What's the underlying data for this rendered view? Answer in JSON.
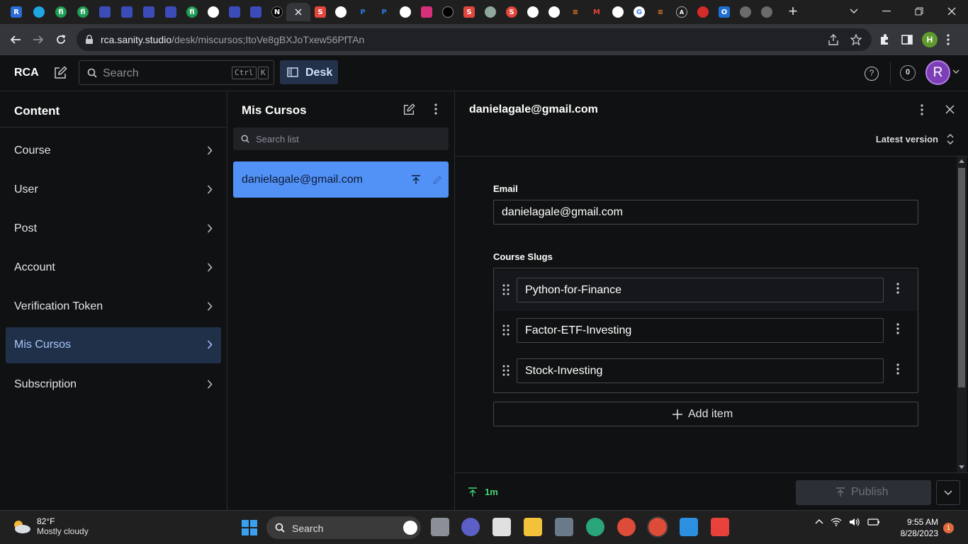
{
  "browser": {
    "url_domain": "rca.sanity.studio",
    "url_path": "/desk/miscursos;ItoVe8gBXJoTxew56PfTAn",
    "profile_initial": "H"
  },
  "app": {
    "brand": "RCA",
    "search_placeholder": "Search",
    "search_kbd_ctrl": "Ctrl",
    "search_kbd_key": "K",
    "desk_label": "Desk",
    "help_label": "?",
    "notification_count": "0",
    "avatar_initial": "R"
  },
  "content_pane": {
    "title": "Content",
    "items": [
      {
        "label": "Course"
      },
      {
        "label": "User"
      },
      {
        "label": "Post"
      },
      {
        "label": "Account"
      },
      {
        "label": "Verification Token"
      },
      {
        "label": "Mis Cursos"
      },
      {
        "label": "Subscription"
      }
    ]
  },
  "list_pane": {
    "title": "Mis Cursos",
    "search_placeholder": "Search list",
    "items": [
      {
        "label": "danielagale@gmail.com"
      }
    ]
  },
  "document": {
    "title": "danielagale@gmail.com",
    "version_label": "Latest version",
    "email_label": "Email",
    "email_value": "danielagale@gmail.com",
    "slugs_label": "Course Slugs",
    "slugs": [
      "Python-for-Finance",
      "Factor-ETF-Investing",
      "Stock-Investing"
    ],
    "add_item_label": "Add item",
    "status_time": "1m",
    "publish_label": "Publish"
  },
  "taskbar": {
    "weather_temp": "82°F",
    "weather_desc": "Mostly cloudy",
    "search_label": "Search",
    "time": "9:55 AM",
    "date": "8/28/2023",
    "notification_badge": "1"
  }
}
